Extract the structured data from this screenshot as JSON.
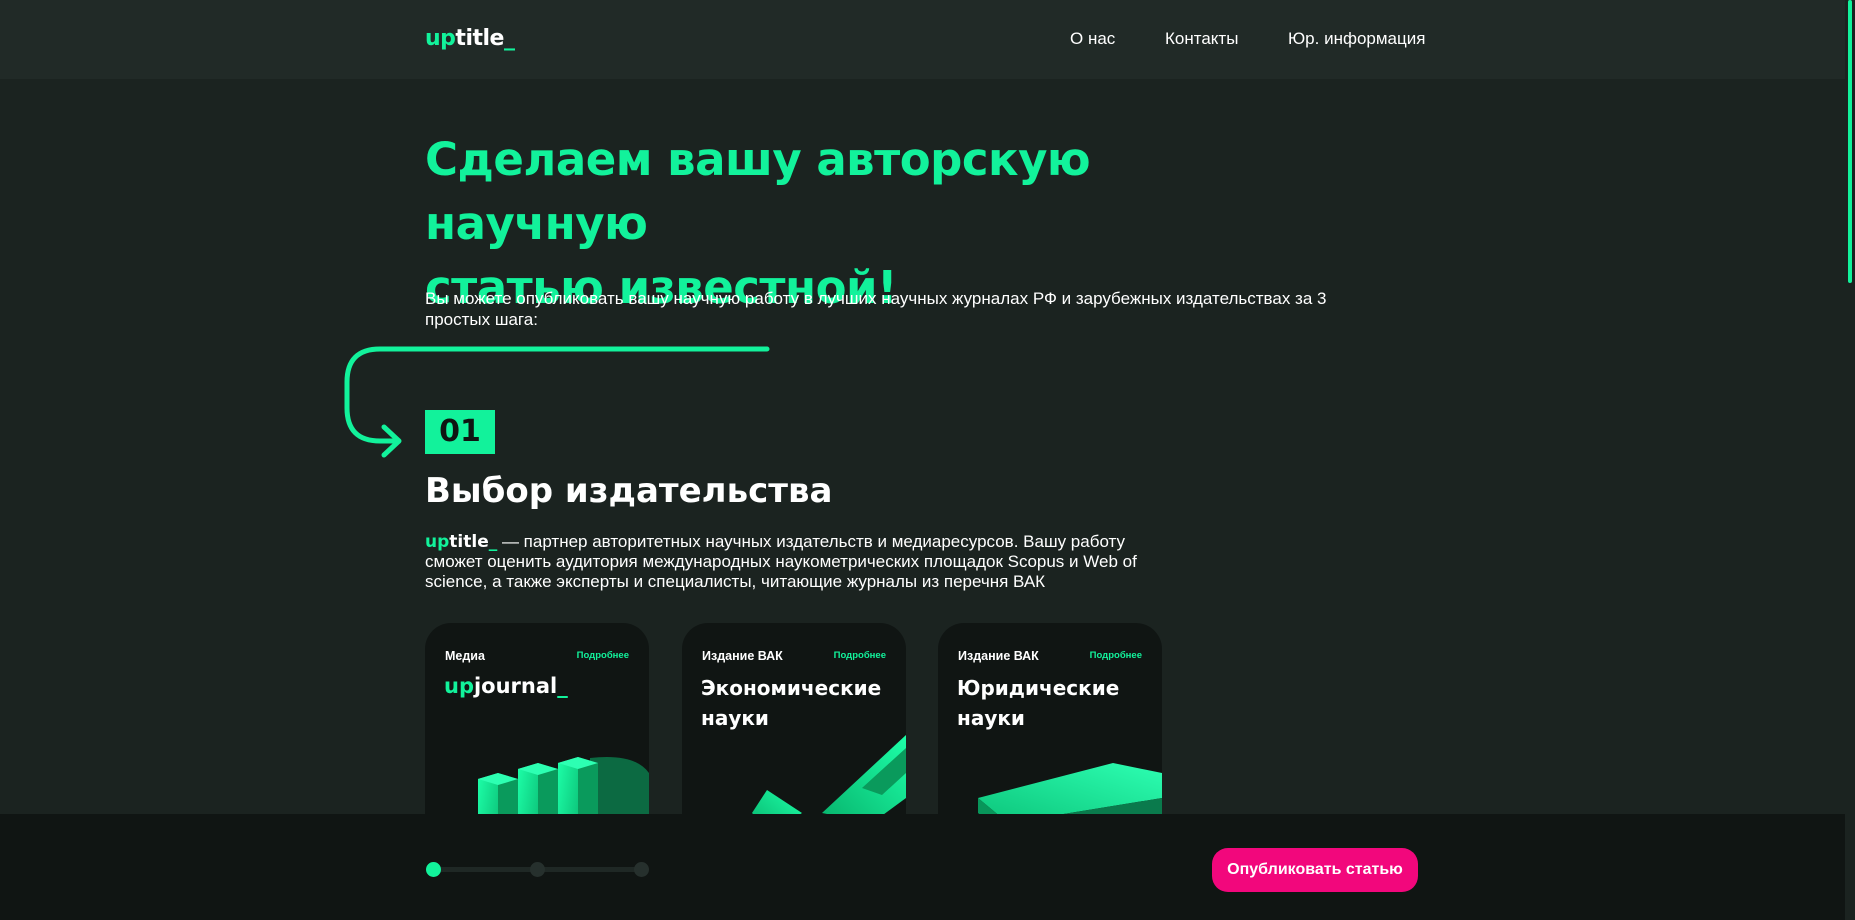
{
  "header": {
    "logo": {
      "up": "up",
      "rest": "title",
      "underscore": "_"
    },
    "nav": [
      "О нас",
      "Контакты",
      "Юр. информация"
    ]
  },
  "hero": {
    "title_line1": "Сделаем вашу авторскую научную",
    "title_line2": "статью известной!",
    "subtitle": "Вы можете опубликовать вашу научную работу в лучших научных журналах РФ и зарубежных издательствах за 3 простых шага:"
  },
  "step": {
    "number": "01",
    "title": "Выбор издательства",
    "description": "— партнер авторитетных научных издательств и медиаресурсов. Вашу работу сможет оценить аудитория международных наукометрических площадок Scopus и Web of science, а также эксперты и специалисты, читающие журналы из перечня ВАК"
  },
  "cards": [
    {
      "label": "Медиа",
      "more": "Подробнее",
      "logo": {
        "up": "up",
        "rest": "journal",
        "underscore": "_"
      }
    },
    {
      "label": "Издание ВАК",
      "more": "Подробнее",
      "title": "Экономические науки"
    },
    {
      "label": "Издание ВАК",
      "more": "Подробнее",
      "title": "Юридические науки"
    }
  ],
  "bottom": {
    "progress": {
      "steps": 3,
      "current": 1
    },
    "publish_button": "Опубликовать статью"
  },
  "colors": {
    "accent": "#12f29b",
    "background": "#1b2320",
    "header": "#212a27",
    "card": "#101513",
    "button": "#f2077c"
  }
}
